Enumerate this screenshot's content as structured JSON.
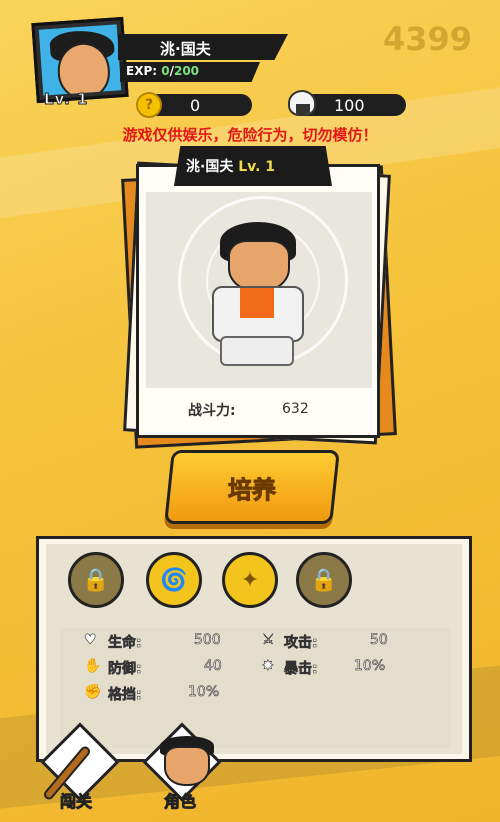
{
  "header": {
    "player_name": "洮·国夫",
    "exp_label": "EXP:",
    "exp_current": "0",
    "exp_separator": "/",
    "exp_max": "200",
    "level_label": "Lv. 1",
    "score": "4399"
  },
  "resources": {
    "coins": "0",
    "rice_balls": "100"
  },
  "warning": "游戏仅供娱乐，危险行为，切勿模仿！",
  "card": {
    "name": "洮·国夫",
    "level": "Lv. 1",
    "power_label": "战斗力:",
    "power_value": "632"
  },
  "train_button": "培养",
  "skills": [
    {
      "state": "locked",
      "icon": "lock-icon"
    },
    {
      "state": "open",
      "icon": "tornado-icon"
    },
    {
      "state": "open",
      "icon": "shuriken-icon"
    },
    {
      "state": "locked",
      "icon": "lock-icon"
    }
  ],
  "stats": {
    "hp_label": "生命:",
    "hp_value": "500",
    "attack_label": "攻击:",
    "attack_value": "50",
    "defense_label": "防御:",
    "defense_value": "40",
    "crit_label": "暴击:",
    "crit_value": "10%",
    "block_label": "格挡:",
    "block_value": "10%"
  },
  "nav": {
    "stages_label": "闯关",
    "character_label": "角色"
  },
  "colors": {
    "background": "#f5c23a",
    "warning": "#e21818",
    "button": "#f5b51f",
    "card_orange": "#e68a1d"
  }
}
